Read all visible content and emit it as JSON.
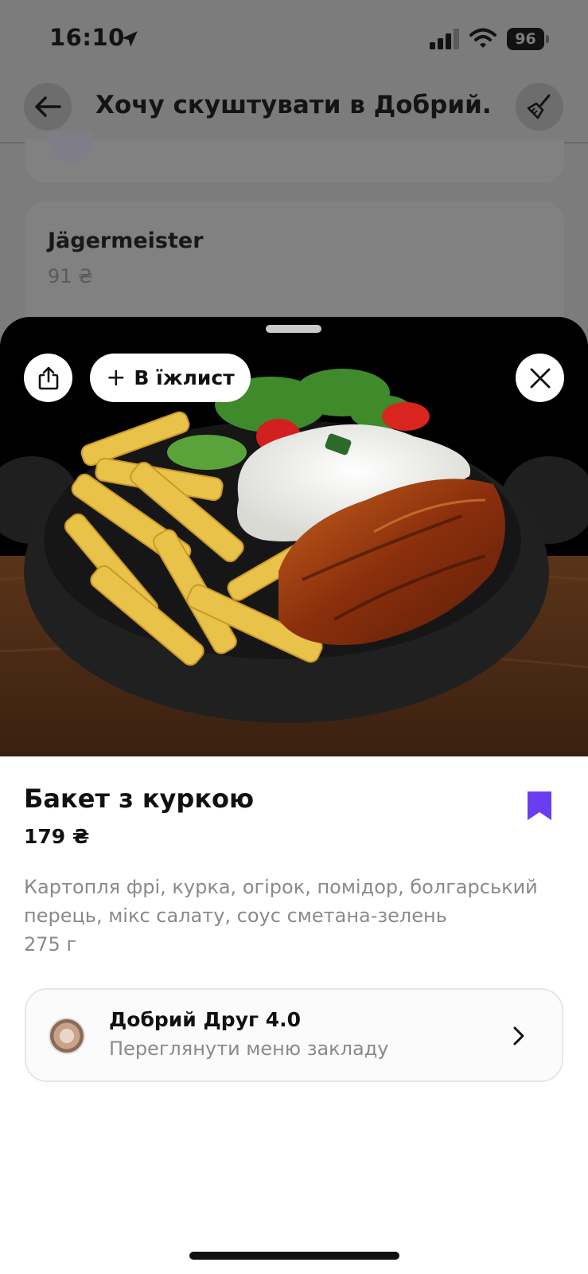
{
  "status_bar": {
    "time": "16:10",
    "battery": "96"
  },
  "nav": {
    "title": "Хочу скуштувати в Добрий..."
  },
  "background_list": {
    "item_title": "Jägermeister",
    "item_price": "91 ₴"
  },
  "sheet": {
    "add_to_list_label": "В їжлист",
    "dish": {
      "title": "Бакет з куркою",
      "price": "179 ₴",
      "description": "Картопля фрі, курка, огірок, помідор, болгарський перець, мікс салату, соус сметана-зелень",
      "weight": "275 г"
    },
    "venue": {
      "name": "Добрий Друг 4.0",
      "subtitle": "Переглянути меню закладу"
    }
  },
  "colors": {
    "accent": "#6b3df0",
    "overlay": "#7c7c7c"
  },
  "icons": [
    "location-arrow-icon",
    "signal-icon",
    "wifi-icon",
    "battery-icon",
    "back-arrow-icon",
    "broom-icon",
    "share-icon",
    "plus-icon",
    "close-icon",
    "bookmark-icon",
    "chevron-right-icon"
  ]
}
